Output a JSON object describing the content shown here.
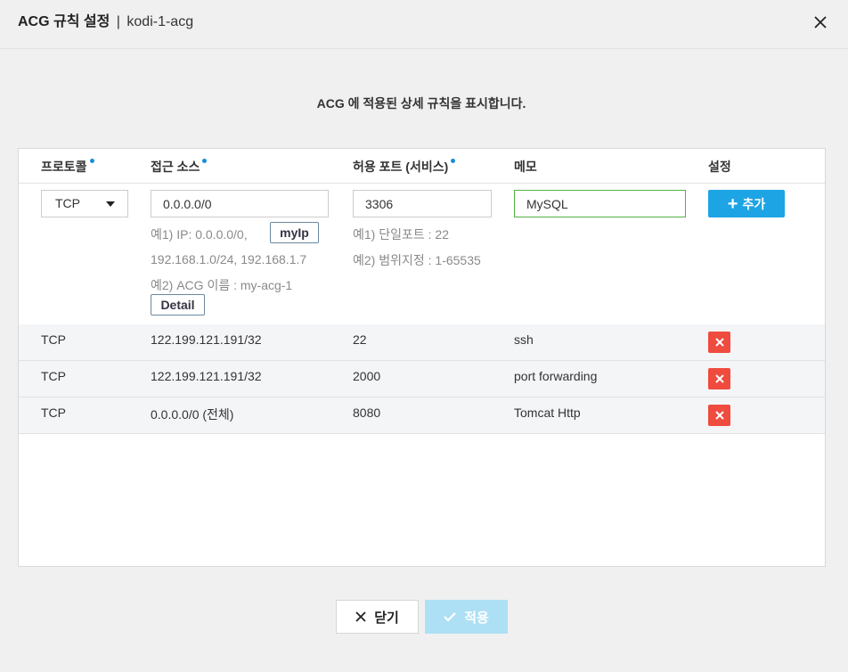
{
  "header": {
    "title": "ACG 규칙 설정",
    "separator": "|",
    "subtitle": "kodi-1-acg"
  },
  "description": "ACG 에 적용된 상세 규칙을 표시합니다.",
  "columns": [
    "프로토콜",
    "접근 소스",
    "허용 포트 (서비스)",
    "메모",
    "설정"
  ],
  "form": {
    "protocol": "TCP",
    "source_value": "0.0.0.0/0",
    "myip_label": "myIp",
    "source_hint_1": "예1) IP: 0.0.0.0/0,",
    "source_hint_2": "192.168.1.0/24, 192.168.1.7",
    "source_hint_3": "예2) ACG 이름 : my-acg-1",
    "detail_label": "Detail",
    "port_value": "3306",
    "port_hint_1": "예1) 단일포트 : 22",
    "port_hint_2": "예2) 범위지정 : 1-65535",
    "memo_value": "MySQL",
    "add_label": "추가"
  },
  "rules": [
    {
      "protocol": "TCP",
      "source": "122.199.121.191/32",
      "port": "22",
      "memo": "ssh"
    },
    {
      "protocol": "TCP",
      "source": "122.199.121.191/32",
      "port": "2000",
      "memo": "port forwarding"
    },
    {
      "protocol": "TCP",
      "source": "0.0.0.0/0 (전체)",
      "port": "8080",
      "memo": "Tomcat Http"
    }
  ],
  "footer": {
    "close_label": "닫기",
    "apply_label": "적용"
  },
  "colors": {
    "accent": "#1da4e4",
    "danger": "#ef4b3e",
    "memo_focus": "#55b047",
    "apply_disabled": "#aee0f5"
  }
}
